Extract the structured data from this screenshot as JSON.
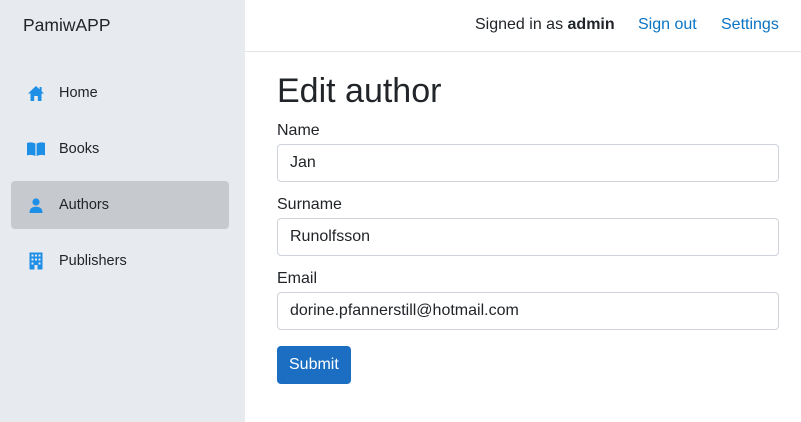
{
  "app": {
    "brand": "PamiwAPP"
  },
  "sidebar": {
    "items": [
      {
        "label": "Home",
        "icon": "home-icon",
        "active": false
      },
      {
        "label": "Books",
        "icon": "book-icon",
        "active": false
      },
      {
        "label": "Authors",
        "icon": "person-icon",
        "active": true
      },
      {
        "label": "Publishers",
        "icon": "building-icon",
        "active": false
      }
    ]
  },
  "topbar": {
    "signed_in_prefix": "Signed in as ",
    "username": "admin",
    "sign_out": "Sign out",
    "settings": "Settings"
  },
  "form": {
    "title": "Edit author",
    "name_label": "Name",
    "name_value": "Jan",
    "surname_label": "Surname",
    "surname_value": "Runolfsson",
    "email_label": "Email",
    "email_value": "dorine.pfannerstill@hotmail.com",
    "submit_label": "Submit"
  },
  "colors": {
    "accent": "#1b6ec2",
    "link": "#0a74c4",
    "icon": "#1e8fe6",
    "sidebar_bg": "#e7eaee",
    "active_item_bg": "#c6cace"
  }
}
